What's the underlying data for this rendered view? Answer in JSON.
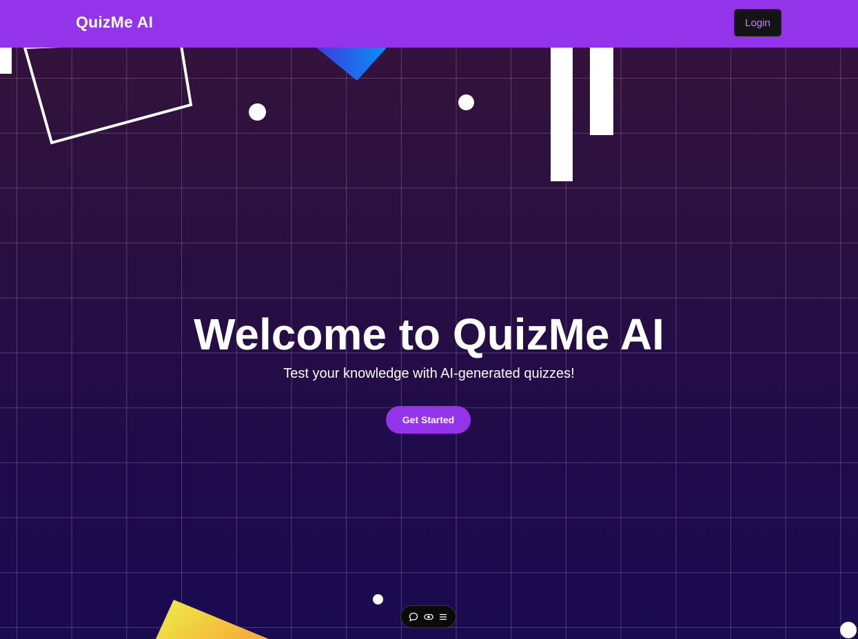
{
  "navbar": {
    "brand": "QuizMe AI",
    "login_label": "Login"
  },
  "hero": {
    "title": "Welcome to QuizMe AI",
    "subtitle": "Test your knowledge with AI-generated quizzes!",
    "cta_label": "Get Started"
  },
  "toolbar": {
    "icons": [
      "chat-icon",
      "eye-icon",
      "menu-icon"
    ]
  },
  "colors": {
    "accent": "#9333ea",
    "login_bg": "#141414",
    "login_text": "#c084fc",
    "text": "#ffffff"
  }
}
